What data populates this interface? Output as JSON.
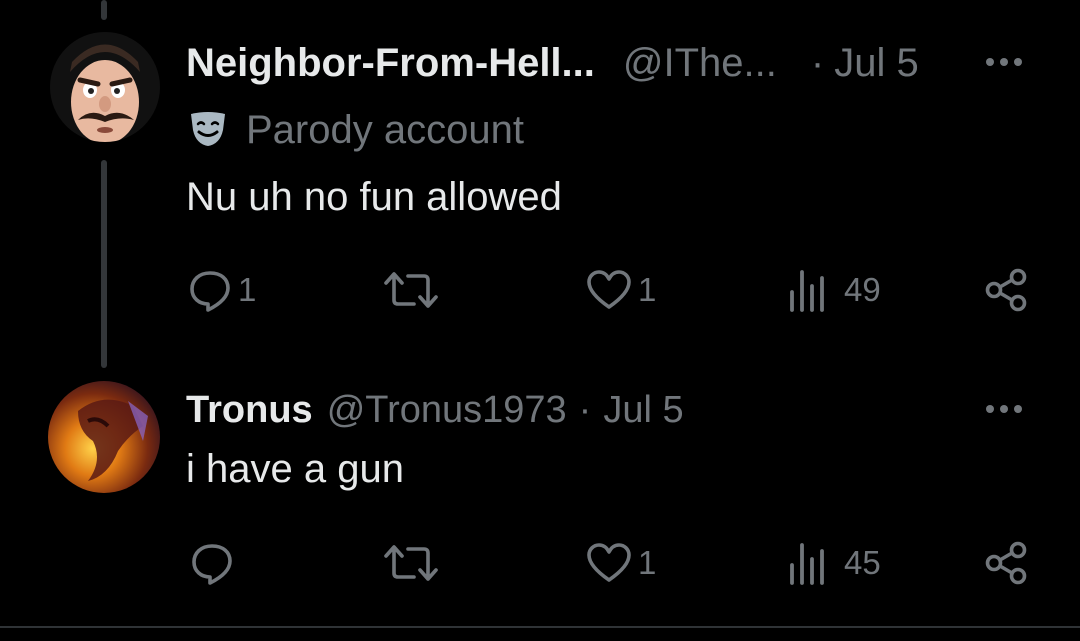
{
  "tweets": [
    {
      "display_name": "Neighbor-From-Hell...",
      "handle": "@IThe...",
      "separator": "·",
      "date": "Jul 5",
      "badge": {
        "icon": "theater-mask-icon",
        "label": "Parody account"
      },
      "text": "Nu uh no fun allowed",
      "actions": {
        "replies": "1",
        "retweets": "",
        "likes": "1",
        "views": "49"
      }
    },
    {
      "display_name": "Tronus",
      "handle": "@Tronus1973",
      "separator": "·",
      "date": "Jul 5",
      "text": "i have a gun",
      "actions": {
        "replies": "",
        "retweets": "",
        "likes": "1",
        "views": "45"
      }
    }
  ],
  "colors": {
    "background": "#000000",
    "text_primary": "#e7e9ea",
    "text_secondary": "#71767b",
    "thread_line": "#333639"
  }
}
